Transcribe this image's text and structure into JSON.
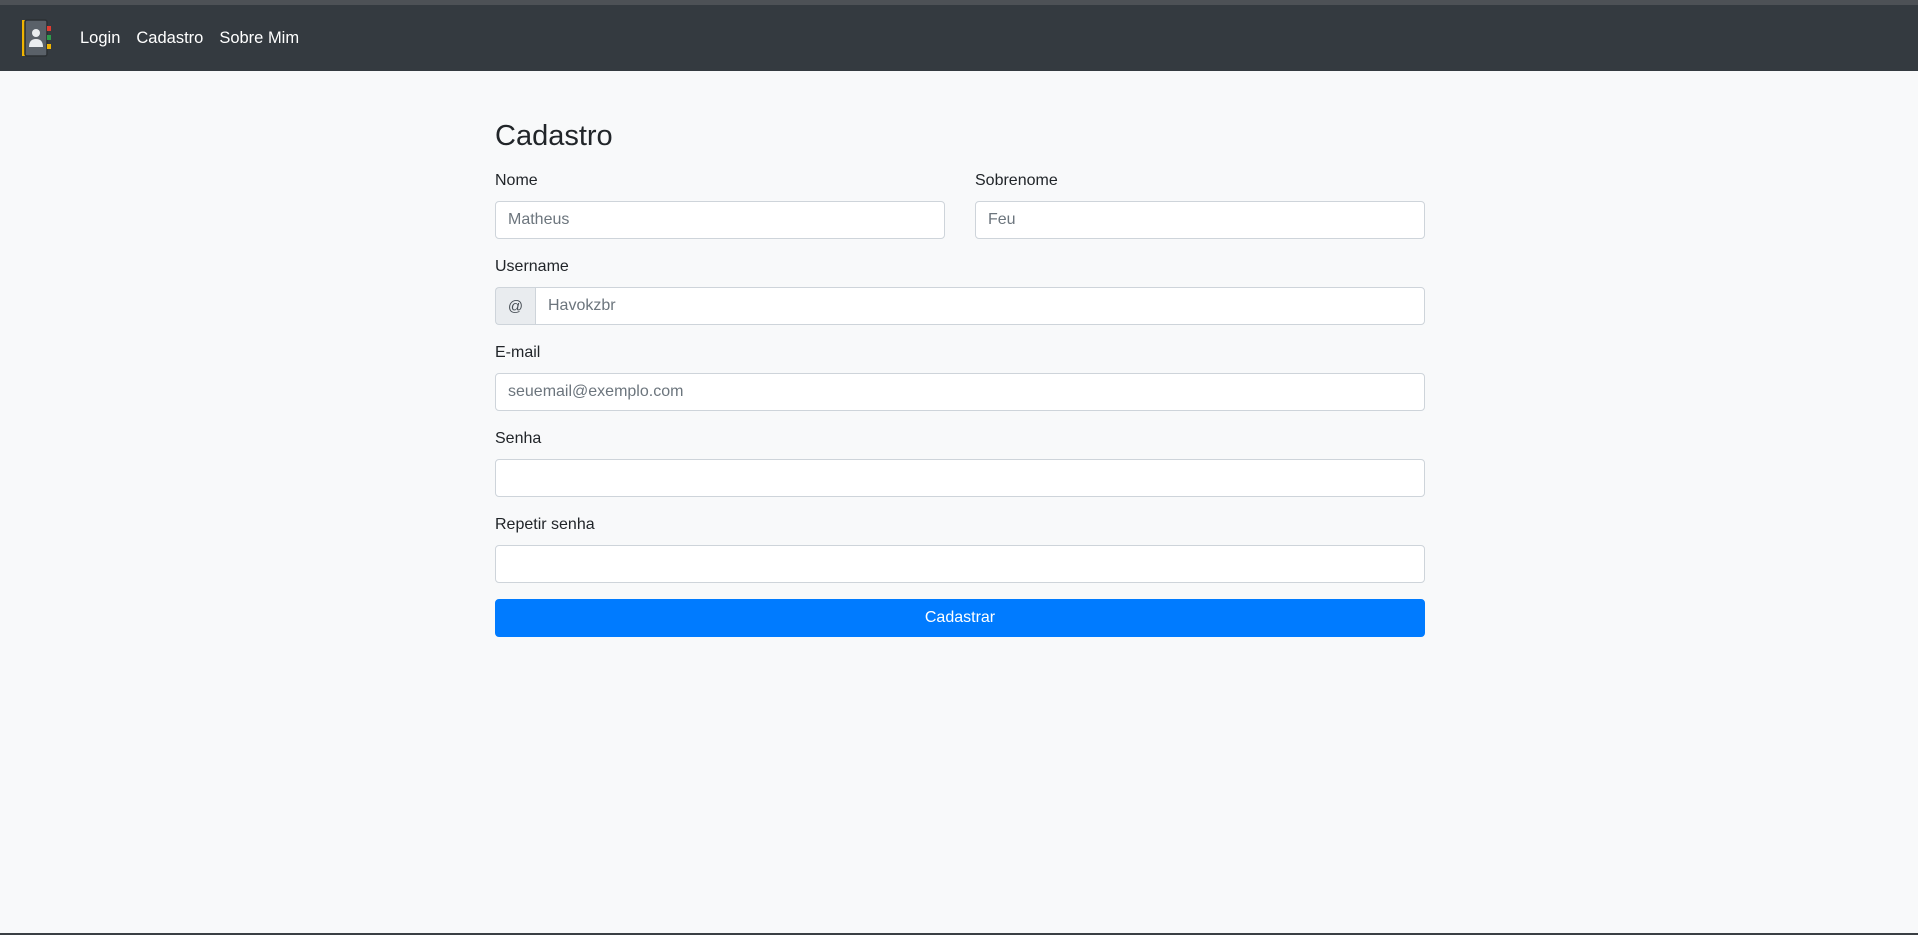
{
  "nav": {
    "brand_icon": "address-book-icon",
    "links": [
      "Login",
      "Cadastro",
      "Sobre Mim"
    ]
  },
  "form": {
    "title": "Cadastro",
    "nome": {
      "label": "Nome",
      "placeholder": "Matheus"
    },
    "sobrenome": {
      "label": "Sobrenome",
      "placeholder": "Feu"
    },
    "username": {
      "label": "Username",
      "prefix": "@",
      "placeholder": "Havokzbr"
    },
    "email": {
      "label": "E-mail",
      "placeholder": "seuemail@exemplo.com"
    },
    "senha": {
      "label": "Senha",
      "placeholder": ""
    },
    "repetir_senha": {
      "label": "Repetir senha",
      "placeholder": ""
    },
    "submit_label": "Cadastrar"
  },
  "colors": {
    "navbar": "#343a40",
    "background": "#f8f9fa",
    "primary": "#007bff"
  }
}
